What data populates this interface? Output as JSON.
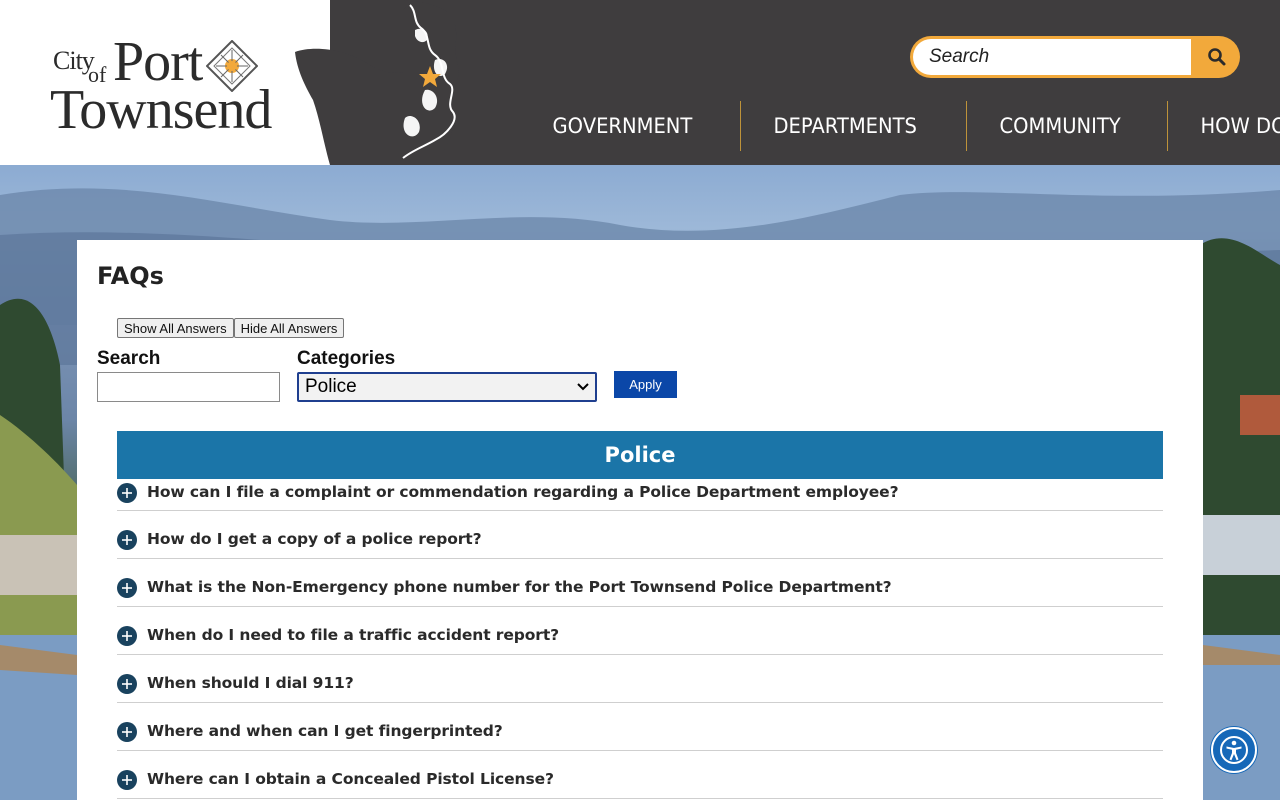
{
  "header": {
    "logo": {
      "city": "City",
      "of": "of",
      "port": "Port",
      "townsend": "Townsend"
    },
    "search": {
      "placeholder": "Search",
      "icon": "search-icon"
    },
    "nav": [
      {
        "label": "GOVERNMENT"
      },
      {
        "label": "DEPARTMENTS"
      },
      {
        "label": "COMMUNITY"
      },
      {
        "label": "HOW DO I"
      }
    ],
    "colors": {
      "bar": "#3f3d3e",
      "accent": "#f2a93b"
    }
  },
  "main": {
    "title": "FAQs",
    "show_all_label": "Show All Answers",
    "hide_all_label": "Hide All Answers",
    "search_label": "Search",
    "search_value": "",
    "categories_label": "Categories",
    "selected_category": "Police",
    "apply_label": "Apply",
    "category_header": "Police",
    "faqs": [
      {
        "question": "How can I file a complaint or commendation regarding a Police Department employee?"
      },
      {
        "question": "How do I get a copy of a police report?"
      },
      {
        "question": "What is the Non-Emergency phone number for the Port Townsend Police Department?"
      },
      {
        "question": "When do I need to file a traffic accident report?"
      },
      {
        "question": "When should I dial 911?"
      },
      {
        "question": "Where and when can I get fingerprinted?"
      },
      {
        "question": "Where can I obtain a Concealed Pistol License?"
      }
    ],
    "colors": {
      "category_header": "#1b75a8",
      "apply": "#0b47a8",
      "faq_icon": "#19425e"
    }
  },
  "accessibility": {
    "icon": "accessibility-icon",
    "color": "#1668b8"
  }
}
